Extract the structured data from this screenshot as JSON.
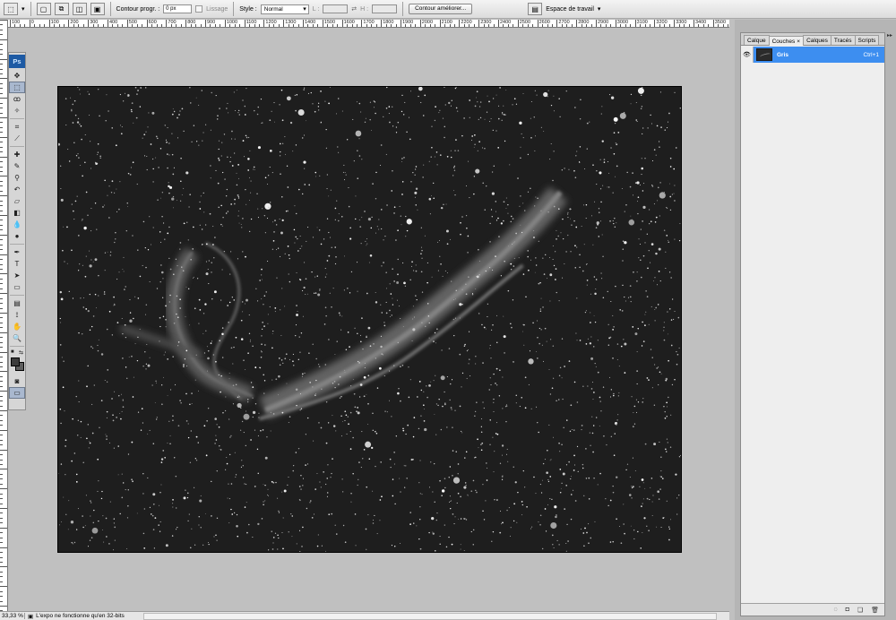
{
  "options_bar": {
    "feather_label": "Contour progr. :",
    "feather_value": "0 px",
    "antialias_label": "Lissage",
    "style_label": "Style :",
    "style_value": "Normal",
    "width_label": "L :",
    "height_label": "H :",
    "refine_edge_button": "Contour améliorer...",
    "workspace_label": "Espace de travail"
  },
  "ruler_top": {
    "labels": [
      "100",
      "0",
      "100",
      "200",
      "300",
      "400",
      "500",
      "600",
      "700",
      "800",
      "900",
      "1000",
      "1100",
      "1200",
      "1300",
      "1400",
      "1500",
      "1600",
      "1700",
      "1800",
      "1900",
      "2000",
      "2100",
      "2200",
      "2300",
      "2400",
      "2500",
      "2600",
      "2700",
      "2800",
      "2900",
      "3000",
      "3100",
      "3200",
      "3300",
      "3400",
      "3500"
    ]
  },
  "toolbox": {
    "logo": "Ps"
  },
  "panel": {
    "tabs": [
      {
        "label": "Calque",
        "active": false
      },
      {
        "label": "Couches",
        "active": true
      },
      {
        "label": "Calques",
        "active": false
      },
      {
        "label": "Tracés",
        "active": false
      },
      {
        "label": "Scripts",
        "active": false
      }
    ],
    "channel": {
      "name": "Gris",
      "shortcut": "Ctrl+1"
    }
  },
  "status_bar": {
    "zoom": "33,33 %",
    "message": "L'expo ne fonctionne qu'en 32-bits"
  },
  "colors": {
    "selection_blue": "#3d8ef0",
    "ps_logo_blue": "#1d5aa4",
    "canvas_bg": "#c0c0c0",
    "image_bg": "#1c1c1c"
  }
}
